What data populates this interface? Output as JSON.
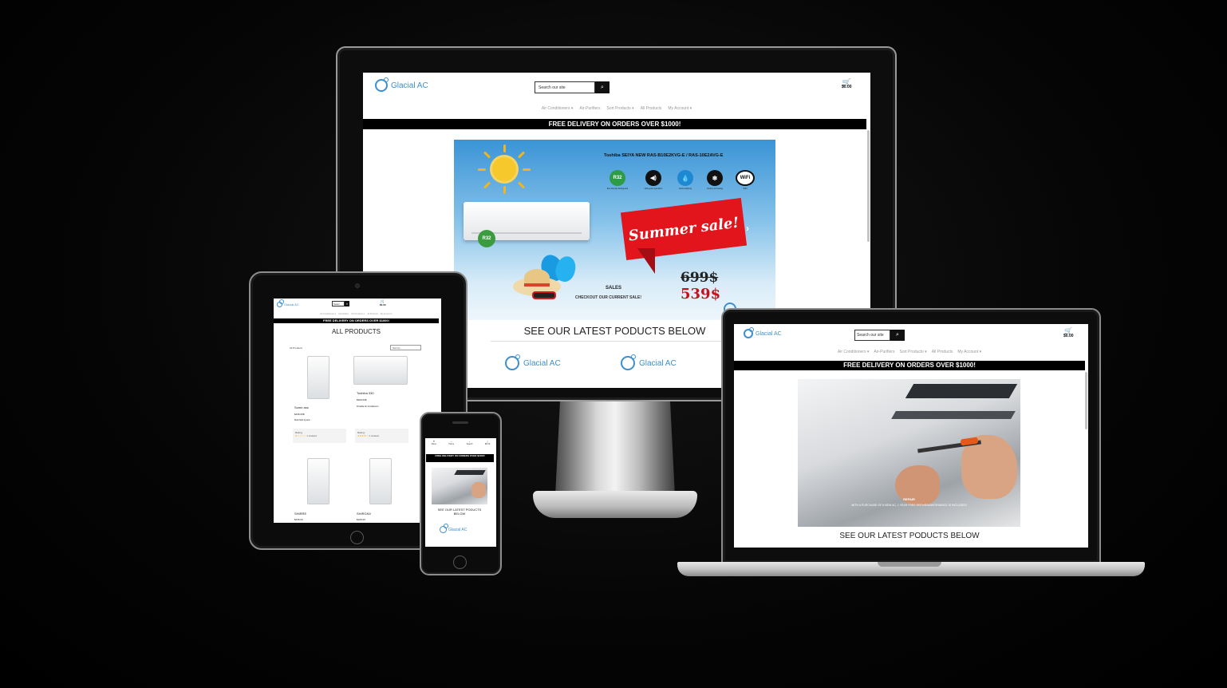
{
  "site": {
    "logo_text": "Glacial AC",
    "search_placeholder": "Search our site",
    "search_short": "Searc",
    "cart_total": "$0.00",
    "nav": [
      "Air Conditioners ▾",
      "Air-Purifiers",
      "Sort Products ▾",
      "All Products",
      "My Account ▾"
    ],
    "banner": "FREE DELIVERY ON ORDERS OVER $1000!",
    "banner_phone": "FREE DELIVERY ON ORDERS OVER $1000!",
    "latest_heading": "SEE OUR LATEST PODUCTS BELOW",
    "all_products_heading": "ALL PRODUCTS"
  },
  "desktop_hero": {
    "product_title": "Toshiba SEIYA NEW RAS-B10E2KVG-E / RAS-10E2AVG-E",
    "features": [
      {
        "icon": "leaf-r32-icon",
        "glyph": "R32",
        "color": "#2e9b46",
        "label": "Eco-friendly Refrigerant"
      },
      {
        "icon": "silent-icon",
        "glyph": "◀)",
        "color": "#111111",
        "label": "Ultra-quiet operation"
      },
      {
        "icon": "water-drop-icon",
        "glyph": "💧",
        "color": "#1e88d0",
        "label": "Dehumidifying"
      },
      {
        "icon": "heat-drop-icon",
        "glyph": "❄",
        "color": "#111111",
        "label": "Cooling & Heating"
      },
      {
        "icon": "wifi-icon",
        "glyph": "WiFi",
        "color": "#111111",
        "label": "WiFi"
      }
    ],
    "ac_badge": "R32",
    "sale_text": "Summer sale!",
    "old_price": "699$",
    "new_price": "539$",
    "sales_title": "SALES",
    "sales_sub": "CHECKOUT OUR CURRENT SALE!",
    "next_arrow": "›"
  },
  "laptop_hero": {
    "caption_title": "REPAIR",
    "caption_text": "WITH A PURCHASE OF A NEW AC, 1 YEAR FREE REPAIR/MAINTENANCE IS INCLUDED!"
  },
  "tablet": {
    "filter_label": "All Products",
    "sort_label": "Sort by...",
    "products": [
      {
        "name": "Some ass",
        "price": "$236.00$",
        "category": "Multi-Split System",
        "rating_label": "Rating:",
        "stars": "★☆☆☆☆",
        "reviews": "1 reviews"
      },
      {
        "name": "Toshiba 330",
        "price": "$300.00$",
        "category": "Portable Air Conditioners",
        "rating_label": "Rating:",
        "stars": "★★★★☆",
        "reviews": "1 reviews"
      },
      {
        "name": "SHIRRE",
        "price": "$235.00",
        "category": "",
        "rating_label": "",
        "stars": "",
        "reviews": ""
      },
      {
        "name": "SHIRGNV",
        "price": "$109.00",
        "category": "",
        "rating_label": "",
        "stars": "",
        "reviews": ""
      }
    ]
  },
  "phone": {
    "menu_items": [
      "Menu",
      "Home",
      "Search",
      "$0.00"
    ]
  }
}
